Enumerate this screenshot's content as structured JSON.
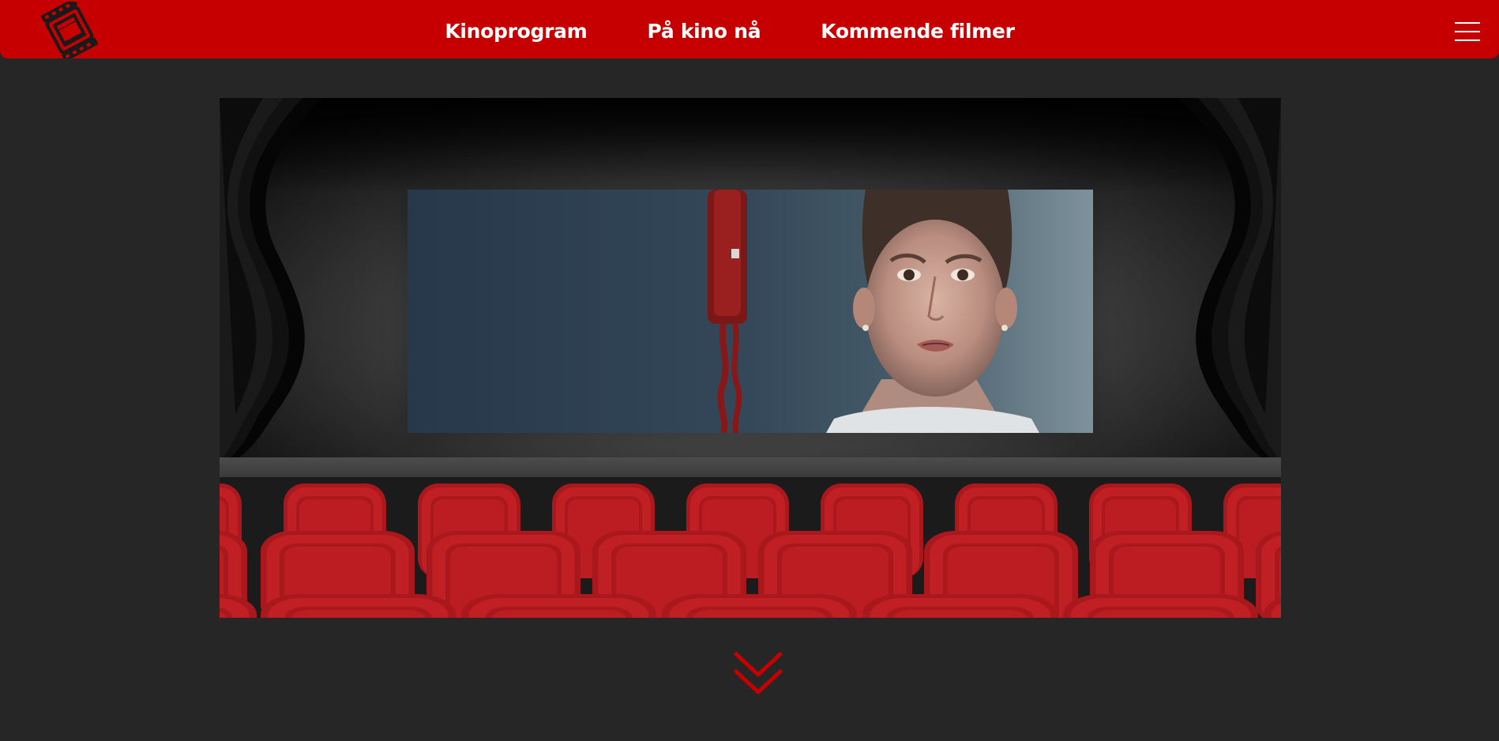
{
  "header": {
    "logo_icon": "film-reel-clapperboard-icon",
    "nav": [
      {
        "label": "Kinoprogram"
      },
      {
        "label": "På kino nå"
      },
      {
        "label": "Kommende filmer"
      }
    ],
    "menu_icon": "hamburger-menu-icon",
    "brand_color": "#c60000"
  },
  "hero": {
    "screen_image": "movie-still-woman-red-wall-phone",
    "seat_color": "#c01f24"
  },
  "scroll_icon": "double-chevron-down-icon"
}
